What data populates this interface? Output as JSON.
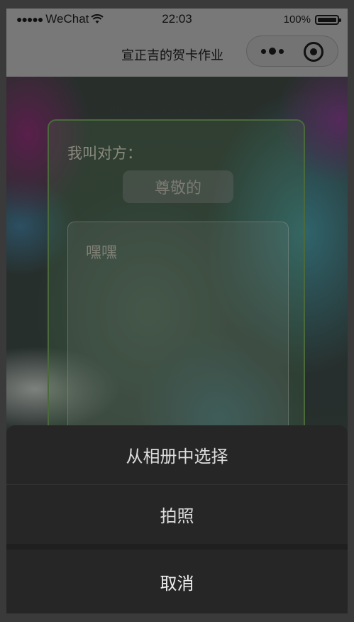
{
  "status_bar": {
    "signal": "●●●●●",
    "carrier": "WeChat",
    "time": "22:03",
    "battery_text": "100%",
    "battery_level": 1.0
  },
  "nav_bar": {
    "title": "宣正吉的贺卡作业",
    "icons": [
      "more-icon",
      "close-circle-icon"
    ]
  },
  "card": {
    "label": "我叫对方：",
    "greeting": "尊敬的",
    "message": "嘿嘿"
  },
  "action_sheet": {
    "items": [
      "从相册中选择",
      "拍照"
    ],
    "cancel": "取消"
  }
}
